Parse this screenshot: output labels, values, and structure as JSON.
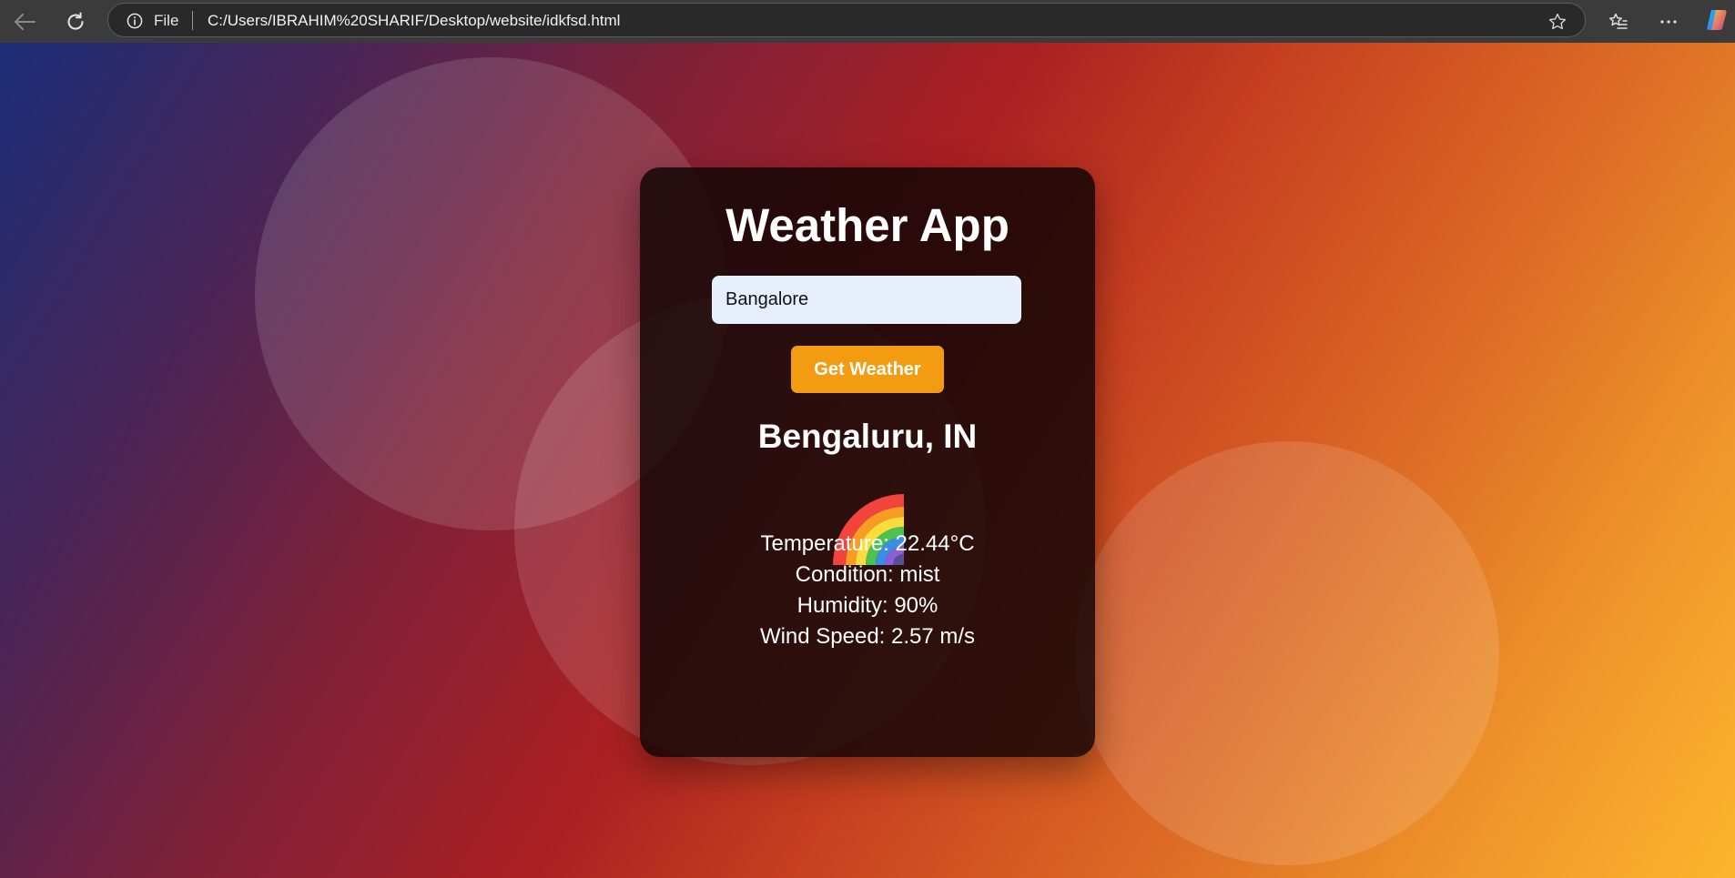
{
  "browser": {
    "scheme_label": "File",
    "url": "C:/Users/IBRAHIM%20SHARIF/Desktop/website/idkfsd.html",
    "icons": [
      "back-arrow-icon",
      "refresh-icon",
      "info-icon",
      "favorite-star-icon",
      "favorites-list-icon",
      "more-options-icon",
      "copilot-icon"
    ]
  },
  "app": {
    "title": "Weather App",
    "search": {
      "value": "Bangalore"
    },
    "button_label": "Get Weather",
    "result": {
      "city": "Bengaluru, IN",
      "icon": "rainbow-icon",
      "temperature_line": "Temperature: 22.44°C",
      "condition_line": "Condition: mist",
      "humidity_line": "Humidity: 90%",
      "wind_line": "Wind Speed: 2.57 m/s"
    }
  },
  "colors": {
    "button": "#f39c12",
    "card": "#140606",
    "input_bg": "#e8effc"
  }
}
